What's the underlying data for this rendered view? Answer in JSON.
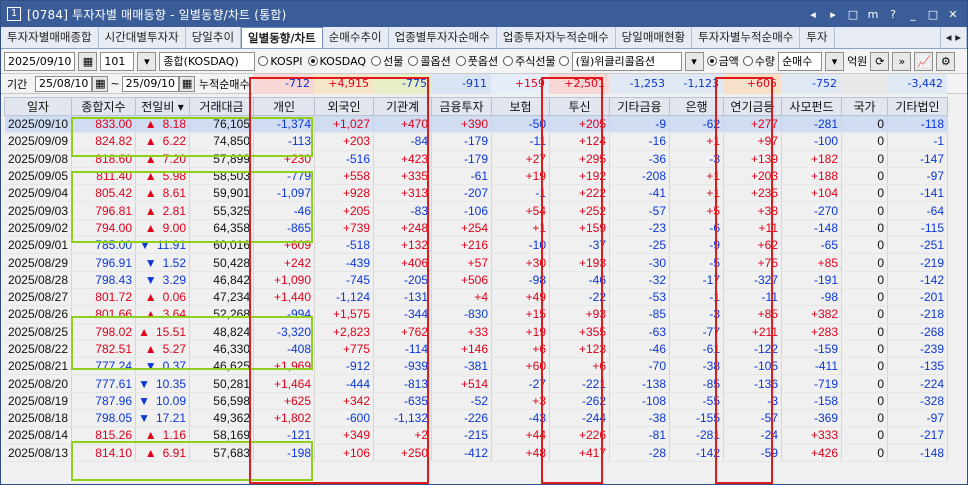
{
  "title": {
    "num": "1",
    "text": "[0784] 투자자별 매매동향 - 일별동향/차트 (통합)"
  },
  "window_controls": [
    "◂",
    "▸",
    "□",
    "m",
    "?",
    "_",
    "□",
    "✕"
  ],
  "tabs": [
    "투자자별매매종합",
    "시간대별투자자",
    "당일추이",
    "일별동향/차트",
    "순매수추이",
    "업종별투자자순매수",
    "업종투자자누적순매수",
    "당일매매현황",
    "투자자별누적순매수",
    "투자"
  ],
  "active_tab": 3,
  "controls": {
    "date": "2025/09/10",
    "code": "101",
    "market": "종합(KOSDAQ)",
    "radios": [
      {
        "label": "KOSPI",
        "on": false
      },
      {
        "label": "KOSDAQ",
        "on": true
      },
      {
        "label": "선물",
        "on": false
      },
      {
        "label": "콜옵션",
        "on": false
      },
      {
        "label": "풋옵션",
        "on": false
      },
      {
        "label": "주식선물",
        "on": false
      }
    ],
    "weekly_option": "(월)위클리콜옵션",
    "amount_radios": [
      {
        "label": "금액",
        "on": true
      },
      {
        "label": "수량",
        "on": false
      }
    ],
    "order_type": "순매수",
    "unit": "억원"
  },
  "period": {
    "label": "기간",
    "from": "25/08/10",
    "to": "25/09/10",
    "cumlabel": "누적순매수"
  },
  "cumulative": [
    "-712",
    "+4,915",
    "-775",
    "-911",
    "+159",
    "+2,501",
    "-1,253",
    "-1,123",
    "+605",
    "-752",
    "",
    "-3,442"
  ],
  "columns": [
    "일자",
    "종합지수",
    "전일비",
    "거래대금",
    "개인",
    "외국인",
    "기관계",
    "금융투자",
    "보험",
    "투신",
    "기타금융",
    "은행",
    "연기금등",
    "사모펀드",
    "국가",
    "기타법인"
  ],
  "rows": [
    [
      "2025/09/10",
      "833.00",
      "u",
      "8.18",
      "76,105",
      "-1,374",
      "+1,027",
      "+470",
      "+390",
      "-50",
      "+205",
      "-9",
      "-62",
      "+277",
      "-281",
      "0",
      "-118"
    ],
    [
      "2025/09/09",
      "824.82",
      "u",
      "6.22",
      "74,850",
      "-113",
      "+203",
      "-84",
      "-179",
      "-11",
      "+124",
      "-16",
      "+1",
      "+97",
      "-100",
      "0",
      "-1"
    ],
    [
      "2025/09/08",
      "818.60",
      "u",
      "7.20",
      "57,899",
      "+230",
      "-516",
      "+423",
      "-179",
      "+27",
      "+295",
      "-36",
      "-3",
      "+139",
      "+182",
      "0",
      "-147"
    ],
    [
      "2025/09/05",
      "811.40",
      "u",
      "5.98",
      "58,503",
      "-779",
      "+558",
      "+335",
      "-61",
      "+19",
      "+192",
      "-208",
      "+1",
      "+203",
      "+188",
      "0",
      "-97"
    ],
    [
      "2025/09/04",
      "805.42",
      "u",
      "8.61",
      "59,901",
      "-1,097",
      "+928",
      "+313",
      "-207",
      "-1",
      "+222",
      "-41",
      "+1",
      "+235",
      "+104",
      "0",
      "-141"
    ],
    [
      "2025/09/03",
      "796.81",
      "u",
      "2.81",
      "55,325",
      "-46",
      "+205",
      "-83",
      "-106",
      "+54",
      "+252",
      "-57",
      "+5",
      "+38",
      "-270",
      "0",
      "-64"
    ],
    [
      "2025/09/02",
      "794.00",
      "u",
      "9.00",
      "64,358",
      "-865",
      "+739",
      "+248",
      "+254",
      "+1",
      "+159",
      "-23",
      "-6",
      "+11",
      "-148",
      "0",
      "-115"
    ],
    [
      "2025/09/01",
      "785.00",
      "d",
      "11.91",
      "60,016",
      "+609",
      "-518",
      "+132",
      "+216",
      "-10",
      "-37",
      "-25",
      "-9",
      "+62",
      "-65",
      "0",
      "-251"
    ],
    [
      "2025/08/29",
      "796.91",
      "d",
      "1.52",
      "50,428",
      "+242",
      "-439",
      "+406",
      "+57",
      "+30",
      "+193",
      "-30",
      "-5",
      "+75",
      "+85",
      "0",
      "-219"
    ],
    [
      "2025/08/28",
      "798.43",
      "d",
      "3.29",
      "46,842",
      "+1,090",
      "-745",
      "-205",
      "+506",
      "-98",
      "-46",
      "-32",
      "-17",
      "-327",
      "-191",
      "0",
      "-142"
    ],
    [
      "2025/08/27",
      "801.72",
      "u",
      "0.06",
      "47,234",
      "+1,440",
      "-1,124",
      "-131",
      "+4",
      "+49",
      "-22",
      "-53",
      "-1",
      "-11",
      "-98",
      "0",
      "-201"
    ],
    [
      "2025/08/26",
      "801.66",
      "u",
      "3.64",
      "52,268",
      "-994",
      "+1,575",
      "-344",
      "-830",
      "+15",
      "+93",
      "-85",
      "-3",
      "+85",
      "+382",
      "0",
      "-218"
    ],
    [
      "2025/08/25",
      "798.02",
      "u",
      "15.51",
      "48,824",
      "-3,320",
      "+2,823",
      "+762",
      "+33",
      "+19",
      "+355",
      "-63",
      "-77",
      "+211",
      "+283",
      "0",
      "-268"
    ],
    [
      "2025/08/22",
      "782.51",
      "u",
      "5.27",
      "46,330",
      "-408",
      "+775",
      "-114",
      "+146",
      "+6",
      "+123",
      "-46",
      "-61",
      "-122",
      "-159",
      "0",
      "-239"
    ],
    [
      "2025/08/21",
      "777.24",
      "d",
      "0.37",
      "46,625",
      "+1,969",
      "-912",
      "-939",
      "-381",
      "+60",
      "+6",
      "-70",
      "-38",
      "-105",
      "-411",
      "0",
      "-135"
    ],
    [
      "2025/08/20",
      "777.61",
      "d",
      "10.35",
      "50,281",
      "+1,464",
      "-444",
      "-813",
      "+514",
      "-27",
      "-221",
      "-138",
      "-85",
      "-136",
      "-719",
      "0",
      "-224"
    ],
    [
      "2025/08/19",
      "787.96",
      "d",
      "10.09",
      "56,598",
      "+625",
      "+342",
      "-635",
      "-52",
      "+3",
      "-262",
      "-108",
      "-55",
      "-3",
      "-158",
      "0",
      "-328"
    ],
    [
      "2025/08/18",
      "798.05",
      "d",
      "17.21",
      "49,362",
      "+1,802",
      "-600",
      "-1,132",
      "-226",
      "-43",
      "-244",
      "-38",
      "-155",
      "-57",
      "-369",
      "0",
      "-97"
    ],
    [
      "2025/08/14",
      "815.26",
      "u",
      "1.16",
      "58,169",
      "-121",
      "+349",
      "+2",
      "-215",
      "+44",
      "+226",
      "-81",
      "-281",
      "-24",
      "+333",
      "0",
      "-217"
    ],
    [
      "2025/08/13",
      "814.10",
      "u",
      "6.91",
      "57,683",
      "-198",
      "+106",
      "+250",
      "-412",
      "+48",
      "+417",
      "-28",
      "-142",
      "-59",
      "+426",
      "0",
      "-148"
    ]
  ]
}
